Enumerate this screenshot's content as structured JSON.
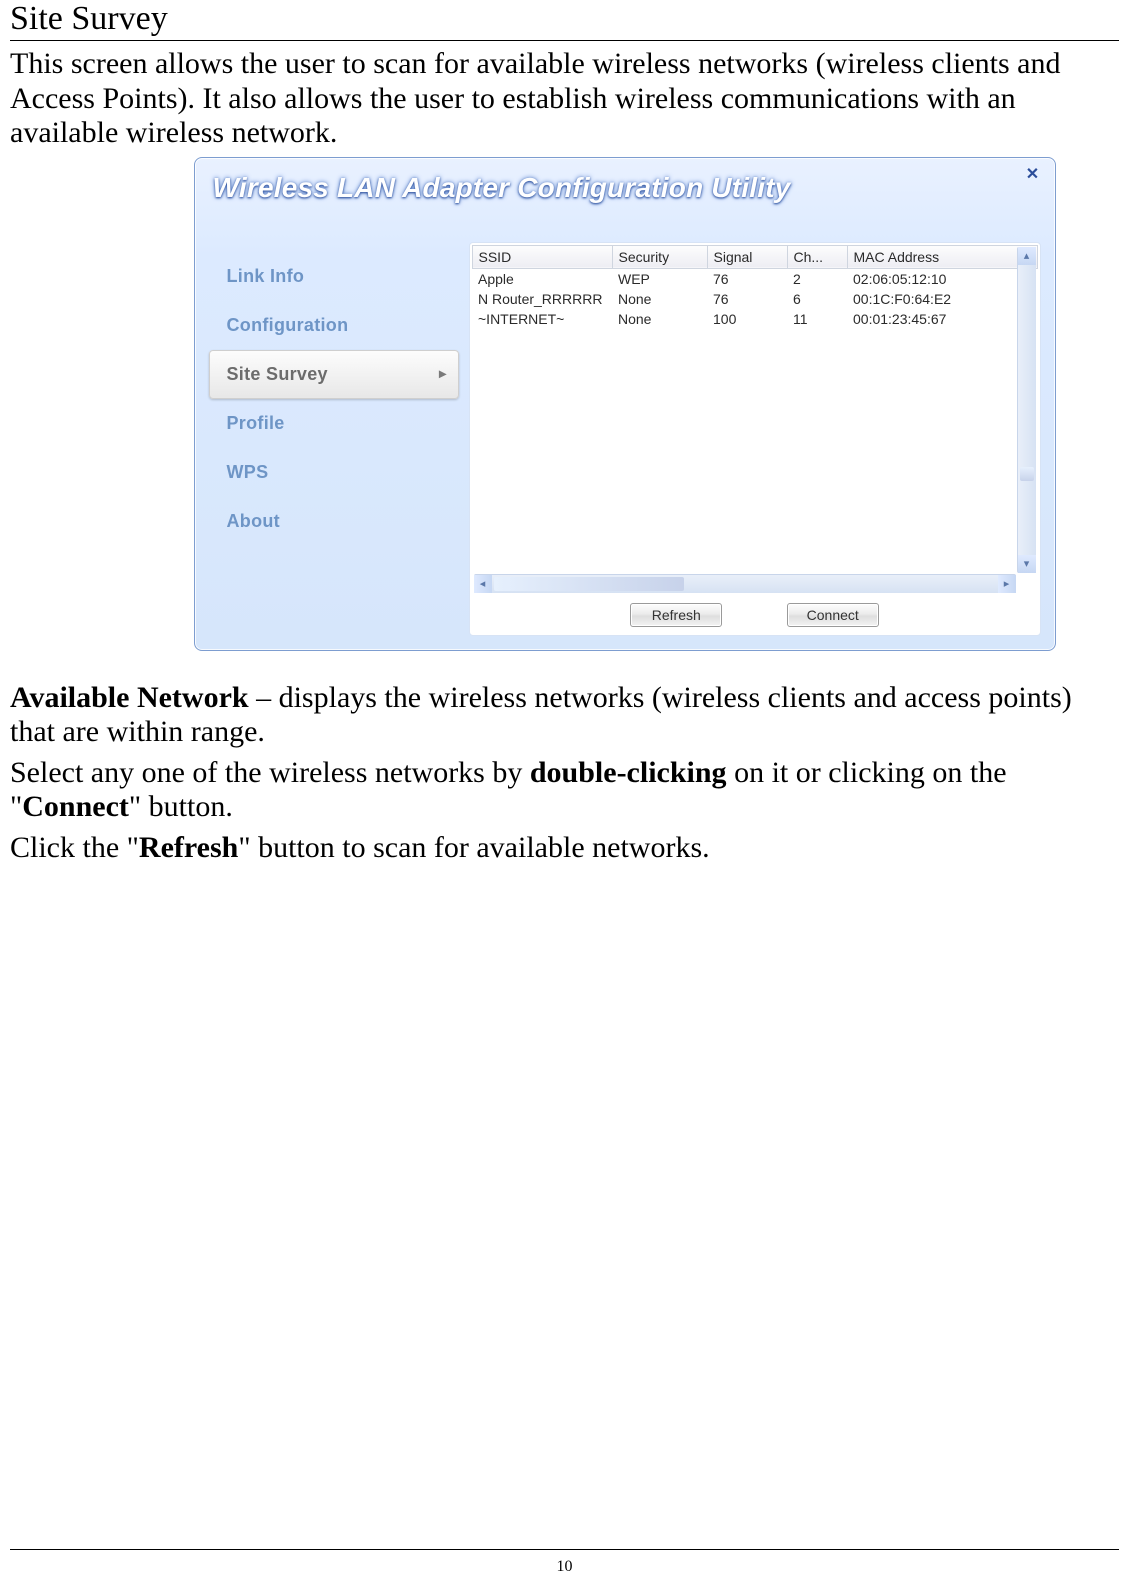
{
  "doc": {
    "section_title": "Site Survey",
    "intro": "This screen allows the user to scan for available wireless networks (wireless clients and Access Points).  It also allows the user to establish wireless communications with an available wireless network.",
    "para2_lead": "Available Network",
    "para2_rest": " – displays the wireless networks (wireless clients and access points) that are within range.",
    "para3_a": "Select any one of the wireless networks by ",
    "para3_b_bold": "double-clicking",
    "para3_c": " on it or clicking  on the \"",
    "para3_d_bold": "Connect",
    "para3_e": "\" button.",
    "para4_a": "Click the \"",
    "para4_b_bold": "Refresh",
    "para4_c": "\" button to scan for available networks.",
    "page_number": "10"
  },
  "app": {
    "title": "Wireless LAN Adapter Configuration Utility",
    "close_glyph": "✕",
    "sidebar": {
      "items": [
        {
          "label": "Link Info",
          "active": false
        },
        {
          "label": "Configuration",
          "active": false
        },
        {
          "label": "Site Survey",
          "active": true
        },
        {
          "label": "Profile",
          "active": false
        },
        {
          "label": "WPS",
          "active": false
        },
        {
          "label": "About",
          "active": false
        }
      ]
    },
    "table": {
      "headers": {
        "ssid": "SSID",
        "security": "Security",
        "signal": "Signal",
        "channel": "Ch...",
        "mac": "MAC Address"
      },
      "rows": [
        {
          "ssid": "Apple",
          "security": "WEP",
          "signal": "76",
          "channel": "2",
          "mac": "02:06:05:12:10"
        },
        {
          "ssid": "N Router_RRRRRR",
          "security": "None",
          "signal": "76",
          "channel": "6",
          "mac": "00:1C:F0:64:E2"
        },
        {
          "ssid": "~INTERNET~",
          "security": "None",
          "signal": "100",
          "channel": "11",
          "mac": "00:01:23:45:67"
        }
      ]
    },
    "buttons": {
      "refresh": "Refresh",
      "connect": "Connect"
    }
  }
}
